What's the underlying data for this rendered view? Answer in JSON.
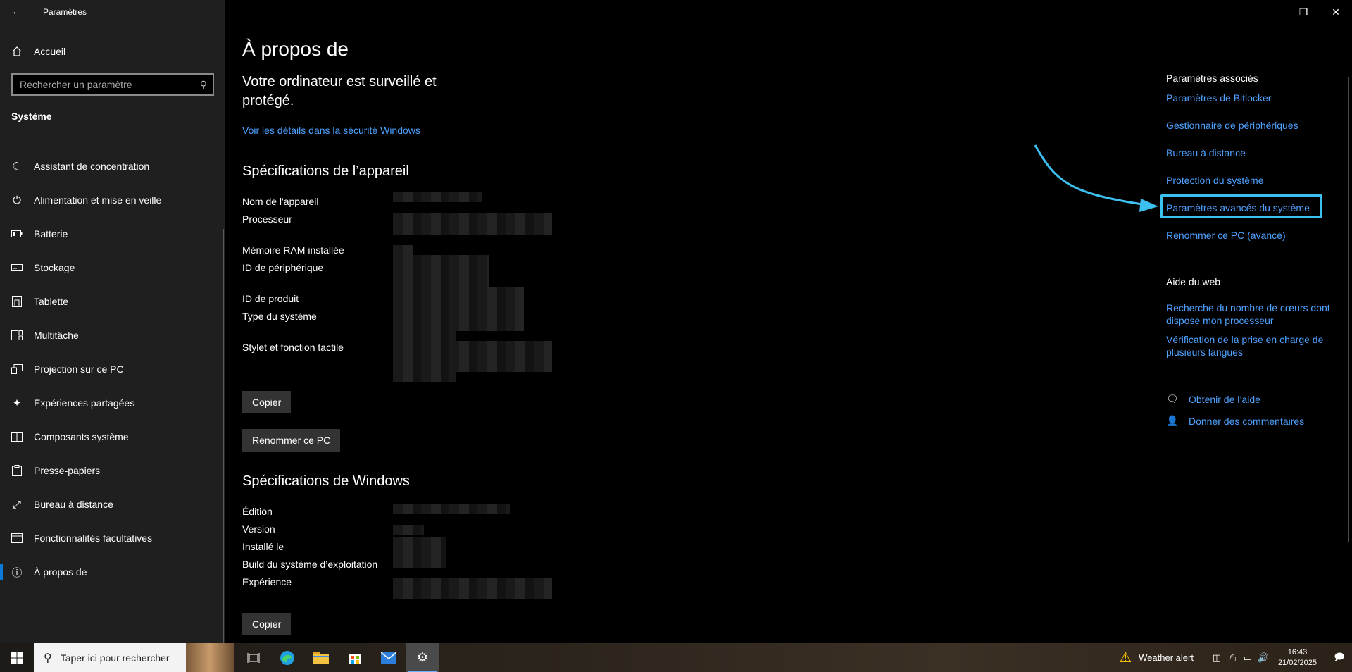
{
  "window": {
    "title": "Paramètres",
    "back_icon": "back-arrow-icon",
    "minimize": "—",
    "maximize": "❐",
    "close": "✕"
  },
  "sidebar": {
    "home_label": "Accueil",
    "search_placeholder": "Rechercher un paramètre",
    "section_label": "Système",
    "items": [
      {
        "label": "Assistant de concentration",
        "icon": "moon-icon"
      },
      {
        "label": "Alimentation et mise en veille",
        "icon": "power-icon"
      },
      {
        "label": "Batterie",
        "icon": "battery-icon"
      },
      {
        "label": "Stockage",
        "icon": "storage-icon"
      },
      {
        "label": "Tablette",
        "icon": "tablet-icon"
      },
      {
        "label": "Multitâche",
        "icon": "multitask-icon"
      },
      {
        "label": "Projection sur ce PC",
        "icon": "projection-icon"
      },
      {
        "label": "Expériences partagées",
        "icon": "shared-icon"
      },
      {
        "label": "Composants système",
        "icon": "components-icon"
      },
      {
        "label": "Presse-papiers",
        "icon": "clipboard-icon"
      },
      {
        "label": "Bureau à distance",
        "icon": "remote-desktop-icon"
      },
      {
        "label": "Fonctionnalités facultatives",
        "icon": "features-icon"
      },
      {
        "label": "À propos de",
        "icon": "info-icon",
        "active": true
      }
    ]
  },
  "main": {
    "title": "À propos de",
    "monitored_text": "Votre ordinateur est surveillé et protégé.",
    "security_link": "Voir les détails dans la sécurité Windows",
    "device_specs_title": "Spécifications de l’appareil",
    "device_specs": [
      "Nom de l'appareil",
      "Processeur",
      "Mémoire RAM installée",
      "ID de périphérique",
      "ID de produit",
      "Type du système",
      "Stylet et fonction tactile"
    ],
    "copy_label": "Copier",
    "rename_label": "Renommer ce PC",
    "windows_specs_title": "Spécifications de Windows",
    "windows_specs": [
      "Édition",
      "Version",
      "Installé le",
      "Build du système d’exploitation",
      "Expérience"
    ],
    "copy2_label": "Copier"
  },
  "right": {
    "related_title": "Paramètres associés",
    "related_links": [
      "Paramètres de Bitlocker",
      "Gestionnaire de périphériques",
      "Bureau à distance",
      "Protection du système",
      "Paramètres avancés du système",
      "Renommer ce PC (avancé)"
    ],
    "web_help_title": "Aide du web",
    "web_links": [
      "Recherche du nombre de cœurs dont dispose mon processeur",
      "Vérification de la prise en charge de plusieurs langues"
    ],
    "get_help": "Obtenir de l’aide",
    "feedback": "Donner des commentaires"
  },
  "taskbar": {
    "search_placeholder": "Taper ici pour rechercher",
    "weather_text": "Weather alert",
    "time": "16:43",
    "date": "21/02/2025"
  },
  "colors": {
    "accent": "#4ea1ff",
    "highlight": "#3cc0f0",
    "sidebar_bg": "#1f1f1f"
  }
}
